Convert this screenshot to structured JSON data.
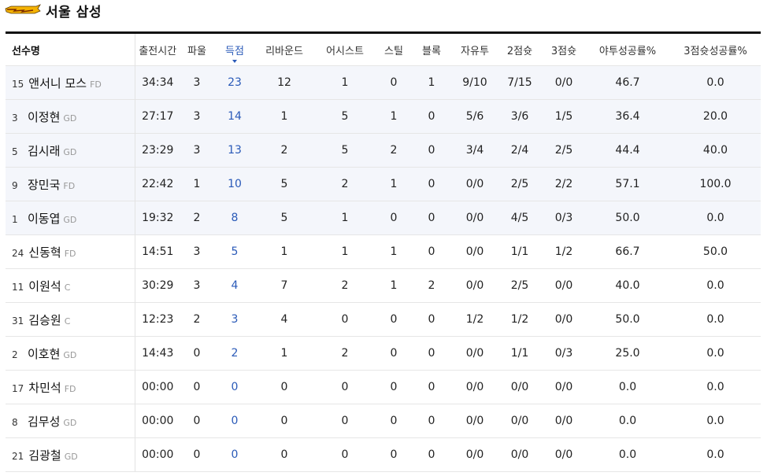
{
  "team": {
    "name": "서울 삼성",
    "logo_icon": "thunders-logo-icon",
    "logo_color": "#f5b301"
  },
  "colors": {
    "accent": "#2a5ab8",
    "row_highlight": "#f4f6fb"
  },
  "headers": {
    "player": "선수명",
    "minutes": "출전시간",
    "fouls": "파울",
    "points": "득점",
    "rebounds": "리바운드",
    "assists": "어시스트",
    "steals": "스틸",
    "blocks": "블록",
    "ft": "자유투",
    "fg2": "2점슛",
    "fg3": "3점슛",
    "fg_pct": "야투성공률%",
    "fg3_pct": "3점슛성공률%"
  },
  "sorted_by": "points",
  "players": [
    {
      "num": "15",
      "name": "앤서니 모스",
      "pos": "FD",
      "min": "34:34",
      "pf": "3",
      "pts": "23",
      "reb": "12",
      "ast": "1",
      "stl": "0",
      "blk": "1",
      "ft": "9/10",
      "fg2": "7/15",
      "fg3": "0/0",
      "fgp": "46.7",
      "fg3p": "0.0"
    },
    {
      "num": "3",
      "name": "이정현",
      "pos": "GD",
      "min": "27:17",
      "pf": "3",
      "pts": "14",
      "reb": "1",
      "ast": "5",
      "stl": "1",
      "blk": "0",
      "ft": "5/6",
      "fg2": "3/6",
      "fg3": "1/5",
      "fgp": "36.4",
      "fg3p": "20.0"
    },
    {
      "num": "5",
      "name": "김시래",
      "pos": "GD",
      "min": "23:29",
      "pf": "3",
      "pts": "13",
      "reb": "2",
      "ast": "5",
      "stl": "2",
      "blk": "0",
      "ft": "3/4",
      "fg2": "2/4",
      "fg3": "2/5",
      "fgp": "44.4",
      "fg3p": "40.0"
    },
    {
      "num": "9",
      "name": "장민국",
      "pos": "FD",
      "min": "22:42",
      "pf": "1",
      "pts": "10",
      "reb": "5",
      "ast": "2",
      "stl": "1",
      "blk": "0",
      "ft": "0/0",
      "fg2": "2/5",
      "fg3": "2/2",
      "fgp": "57.1",
      "fg3p": "100.0"
    },
    {
      "num": "1",
      "name": "이동엽",
      "pos": "GD",
      "min": "19:32",
      "pf": "2",
      "pts": "8",
      "reb": "5",
      "ast": "1",
      "stl": "0",
      "blk": "0",
      "ft": "0/0",
      "fg2": "4/5",
      "fg3": "0/3",
      "fgp": "50.0",
      "fg3p": "0.0"
    },
    {
      "num": "24",
      "name": "신동혁",
      "pos": "FD",
      "min": "14:51",
      "pf": "3",
      "pts": "5",
      "reb": "1",
      "ast": "1",
      "stl": "1",
      "blk": "0",
      "ft": "0/0",
      "fg2": "1/1",
      "fg3": "1/2",
      "fgp": "66.7",
      "fg3p": "50.0"
    },
    {
      "num": "11",
      "name": "이원석",
      "pos": "C",
      "min": "30:29",
      "pf": "3",
      "pts": "4",
      "reb": "7",
      "ast": "2",
      "stl": "1",
      "blk": "2",
      "ft": "0/0",
      "fg2": "2/5",
      "fg3": "0/0",
      "fgp": "40.0",
      "fg3p": "0.0"
    },
    {
      "num": "31",
      "name": "김승원",
      "pos": "C",
      "min": "12:23",
      "pf": "2",
      "pts": "3",
      "reb": "4",
      "ast": "0",
      "stl": "0",
      "blk": "0",
      "ft": "1/2",
      "fg2": "1/2",
      "fg3": "0/0",
      "fgp": "50.0",
      "fg3p": "0.0"
    },
    {
      "num": "2",
      "name": "이호현",
      "pos": "GD",
      "min": "14:43",
      "pf": "0",
      "pts": "2",
      "reb": "1",
      "ast": "2",
      "stl": "0",
      "blk": "0",
      "ft": "0/0",
      "fg2": "1/1",
      "fg3": "0/3",
      "fgp": "25.0",
      "fg3p": "0.0"
    },
    {
      "num": "17",
      "name": "차민석",
      "pos": "FD",
      "min": "00:00",
      "pf": "0",
      "pts": "0",
      "reb": "0",
      "ast": "0",
      "stl": "0",
      "blk": "0",
      "ft": "0/0",
      "fg2": "0/0",
      "fg3": "0/0",
      "fgp": "0.0",
      "fg3p": "0.0"
    },
    {
      "num": "8",
      "name": "김무성",
      "pos": "GD",
      "min": "00:00",
      "pf": "0",
      "pts": "0",
      "reb": "0",
      "ast": "0",
      "stl": "0",
      "blk": "0",
      "ft": "0/0",
      "fg2": "0/0",
      "fg3": "0/0",
      "fgp": "0.0",
      "fg3p": "0.0"
    },
    {
      "num": "21",
      "name": "김광철",
      "pos": "GD",
      "min": "00:00",
      "pf": "0",
      "pts": "0",
      "reb": "0",
      "ast": "0",
      "stl": "0",
      "blk": "0",
      "ft": "0/0",
      "fg2": "0/0",
      "fg3": "0/0",
      "fgp": "0.0",
      "fg3p": "0.0"
    }
  ]
}
